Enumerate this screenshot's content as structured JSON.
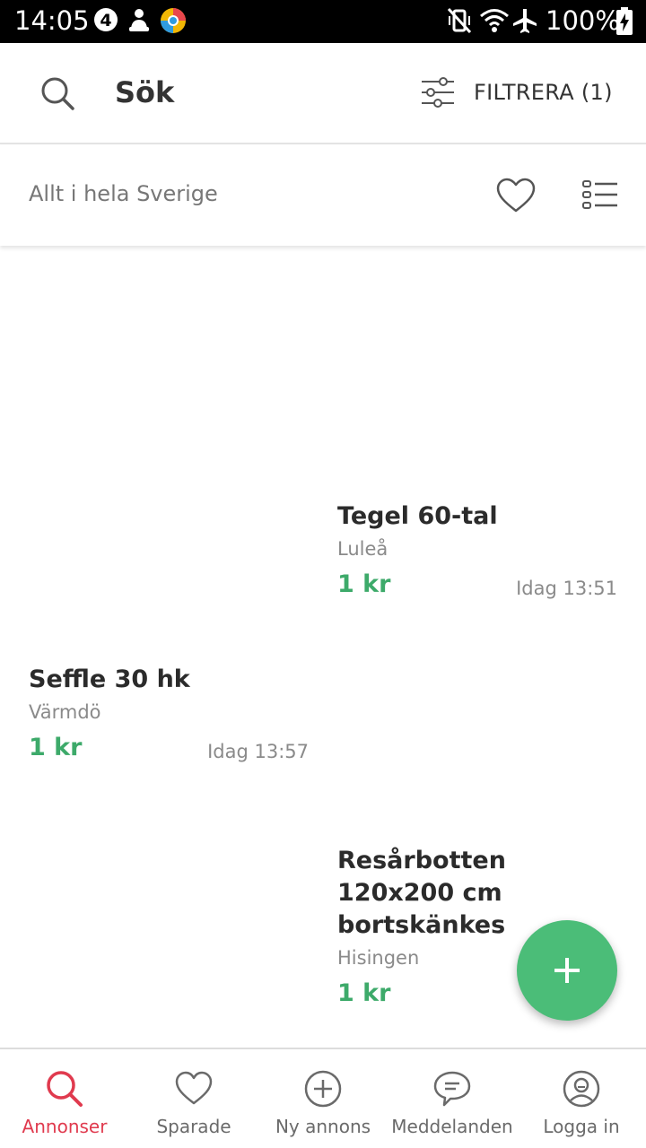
{
  "status_bar": {
    "time": "14:05",
    "battery": "100%",
    "notification_icons": [
      "number-4-icon",
      "person-icon",
      "chrome-app-icon"
    ],
    "system_icons": [
      "vibrate-icon",
      "wifi-icon",
      "airplane-icon",
      "battery-charging-icon"
    ]
  },
  "header": {
    "title": "Sök",
    "filter_label": "FILTRERA (1)"
  },
  "location_bar": {
    "text": "Allt i hela Sverige"
  },
  "listings": [
    {
      "title": "Tegel 60-tal",
      "location": "Luleå",
      "price": "1 kr",
      "time": "Idag 13:51"
    },
    {
      "title": "Seffle 30 hk",
      "location": "Värmdö",
      "price": "1 kr",
      "time": "Idag 13:57"
    },
    {
      "title": "Resårbotten 120x200 cm bortskänkes",
      "location": "Hisingen",
      "price": "1 kr",
      "time": ""
    }
  ],
  "bottom_nav": {
    "items": [
      {
        "label": "Annonser",
        "icon": "search-icon",
        "active": true
      },
      {
        "label": "Sparade",
        "icon": "heart-icon",
        "active": false
      },
      {
        "label": "Ny annons",
        "icon": "plus-circle-icon",
        "active": false
      },
      {
        "label": "Meddelanden",
        "icon": "chat-bubble-icon",
        "active": false
      },
      {
        "label": "Logga in",
        "icon": "user-icon",
        "active": false
      }
    ]
  },
  "colors": {
    "accent_active": "#e03a4e",
    "price_green": "#3daa6a",
    "fab_green": "#4bbd78"
  }
}
